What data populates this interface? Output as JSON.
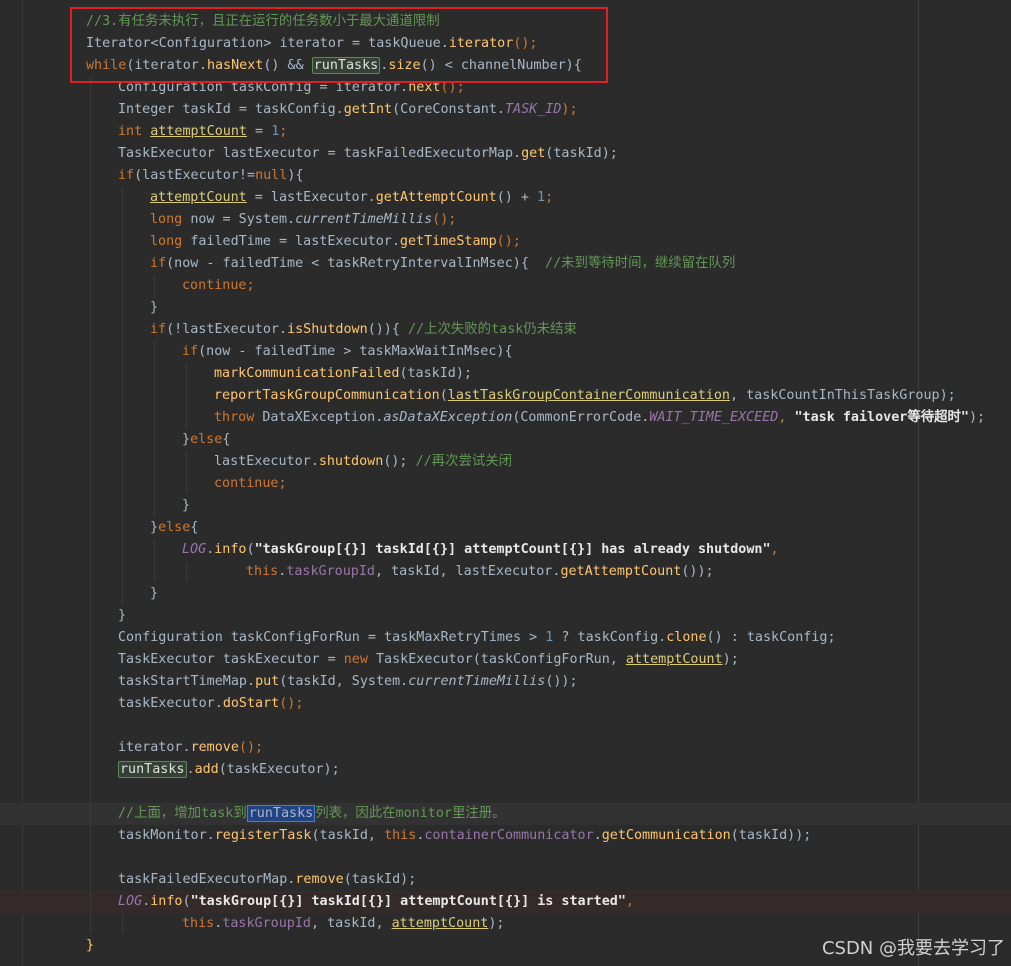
{
  "editor": {
    "lines": [
      {
        "segments": [
          {
            "t": "//3.有任务未执行，且正在运行的任务数小于最大通道限制",
            "c": "cm"
          }
        ]
      },
      {
        "segments": [
          {
            "t": "Iterator",
            "c": ""
          },
          {
            "t": "<",
            "c": "gen"
          },
          {
            "t": "Configuration",
            "c": ""
          },
          {
            "t": "> iterator = taskQueue.",
            "c": ""
          },
          {
            "t": "iterator",
            "c": "fn"
          },
          {
            "t": "();",
            "c": "kw"
          }
        ]
      },
      {
        "segments": [
          {
            "t": "while",
            "c": "kw"
          },
          {
            "t": "(iterator.",
            "c": ""
          },
          {
            "t": "hasNext",
            "c": "fn"
          },
          {
            "t": "() && ",
            "c": ""
          },
          {
            "t": "runTasks",
            "c": "hl"
          },
          {
            "t": ".",
            "c": ""
          },
          {
            "t": "size",
            "c": "fn"
          },
          {
            "t": "() < channelNumber){",
            "c": ""
          }
        ]
      },
      {
        "segments": [
          {
            "t": "Configuration taskConfig = iterator.",
            "c": ""
          },
          {
            "t": "next",
            "c": "fn"
          },
          {
            "t": "();",
            "c": "kw"
          }
        ]
      },
      {
        "segments": [
          {
            "t": "Integer taskId = taskConfig.",
            "c": ""
          },
          {
            "t": "getInt",
            "c": "fn"
          },
          {
            "t": "(CoreConstant.",
            "c": ""
          },
          {
            "t": "TASK_ID",
            "c": "sfld"
          },
          {
            "t": ");",
            "c": "kw"
          }
        ]
      },
      {
        "segments": [
          {
            "t": "int ",
            "c": "kw"
          },
          {
            "t": "attemptCount",
            "c": "und"
          },
          {
            "t": " = ",
            "c": ""
          },
          {
            "t": "1",
            "c": "num"
          },
          {
            "t": ";",
            "c": "kw"
          }
        ]
      },
      {
        "segments": [
          {
            "t": "TaskExecutor lastExecutor = taskFailedExecutorMap.",
            "c": ""
          },
          {
            "t": "get",
            "c": "fn"
          },
          {
            "t": "(taskId);",
            "c": ""
          }
        ]
      },
      {
        "segments": [
          {
            "t": "if",
            "c": "kw"
          },
          {
            "t": "(lastExecutor!=",
            "c": ""
          },
          {
            "t": "null",
            "c": "kw"
          },
          {
            "t": "){",
            "c": ""
          }
        ]
      },
      {
        "segments": [
          {
            "t": "attemptCount",
            "c": "und"
          },
          {
            "t": " = lastExecutor.",
            "c": ""
          },
          {
            "t": "getAttemptCount",
            "c": "fn"
          },
          {
            "t": "() + ",
            "c": ""
          },
          {
            "t": "1",
            "c": "num"
          },
          {
            "t": ";",
            "c": "kw"
          }
        ]
      },
      {
        "segments": [
          {
            "t": "long ",
            "c": "kw"
          },
          {
            "t": "now = System.",
            "c": ""
          },
          {
            "t": "currentTimeMillis",
            "c": "sm"
          },
          {
            "t": "();",
            "c": "kw"
          }
        ]
      },
      {
        "segments": [
          {
            "t": "long ",
            "c": "kw"
          },
          {
            "t": "failedTime = lastExecutor.",
            "c": ""
          },
          {
            "t": "getTimeStamp",
            "c": "fn"
          },
          {
            "t": "();",
            "c": "kw"
          }
        ]
      },
      {
        "segments": [
          {
            "t": "if",
            "c": "kw"
          },
          {
            "t": "(now - failedTime < taskRetryIntervalInMsec){  ",
            "c": ""
          },
          {
            "t": "//未到等待时间，继续留在队列",
            "c": "cm"
          }
        ]
      },
      {
        "segments": [
          {
            "t": "continue;",
            "c": "kw"
          }
        ]
      },
      {
        "segments": [
          {
            "t": "}",
            "c": ""
          }
        ]
      },
      {
        "segments": [
          {
            "t": "if",
            "c": "kw"
          },
          {
            "t": "(!lastExecutor.",
            "c": ""
          },
          {
            "t": "isShutdown",
            "c": "fn"
          },
          {
            "t": "()){ ",
            "c": ""
          },
          {
            "t": "//上次失败的task仍未结束",
            "c": "cm"
          }
        ]
      },
      {
        "segments": [
          {
            "t": "if",
            "c": "kw"
          },
          {
            "t": "(now - failedTime > taskMaxWaitInMsec){",
            "c": ""
          }
        ]
      },
      {
        "segments": [
          {
            "t": "markCommunicationFailed",
            "c": "fn"
          },
          {
            "t": "(taskId);",
            "c": ""
          }
        ]
      },
      {
        "segments": [
          {
            "t": "reportTaskGroupCommunication",
            "c": "fn"
          },
          {
            "t": "(",
            "c": ""
          },
          {
            "t": "lastTaskGroupContainerCommunication",
            "c": "und"
          },
          {
            "t": ", taskCountInThisTaskGroup);",
            "c": ""
          }
        ]
      },
      {
        "segments": [
          {
            "t": "throw ",
            "c": "kw"
          },
          {
            "t": "DataXException.",
            "c": ""
          },
          {
            "t": "asDataXException",
            "c": "sm"
          },
          {
            "t": "(CommonErrorCode.",
            "c": ""
          },
          {
            "t": "WAIT_TIME_EXCEED",
            "c": "sfld"
          },
          {
            "t": ", ",
            "c": "kw"
          },
          {
            "t": "\"task failover等待超时\"",
            "c": "str2"
          },
          {
            "t": ");",
            "c": ""
          }
        ]
      },
      {
        "segments": [
          {
            "t": "}",
            "c": ""
          },
          {
            "t": "else",
            "c": "kw"
          },
          {
            "t": "{",
            "c": ""
          }
        ]
      },
      {
        "segments": [
          {
            "t": "lastExecutor.",
            "c": ""
          },
          {
            "t": "shutdown",
            "c": "fn"
          },
          {
            "t": "(); ",
            "c": ""
          },
          {
            "t": "//再次尝试关闭",
            "c": "cm"
          }
        ]
      },
      {
        "segments": [
          {
            "t": "continue;",
            "c": "kw"
          }
        ]
      },
      {
        "segments": [
          {
            "t": "}",
            "c": ""
          }
        ]
      },
      {
        "segments": [
          {
            "t": "}",
            "c": ""
          },
          {
            "t": "else",
            "c": "kw"
          },
          {
            "t": "{",
            "c": ""
          }
        ]
      },
      {
        "segments": [
          {
            "t": "LOG",
            "c": "sfld"
          },
          {
            "t": ".",
            "c": ""
          },
          {
            "t": "info",
            "c": "fn"
          },
          {
            "t": "(",
            "c": ""
          },
          {
            "t": "\"taskGroup[{}] taskId[{}] attemptCount[{}] has already shutdown\"",
            "c": "str2"
          },
          {
            "t": ",",
            "c": "kw"
          }
        ]
      },
      {
        "segments": [
          {
            "t": "this",
            "c": "kw"
          },
          {
            "t": ".",
            "c": ""
          },
          {
            "t": "taskGroupId",
            "c": "fld"
          },
          {
            "t": ", taskId, lastExecutor.",
            "c": ""
          },
          {
            "t": "getAttemptCount",
            "c": "fn"
          },
          {
            "t": "());",
            "c": ""
          }
        ]
      },
      {
        "segments": [
          {
            "t": "}",
            "c": ""
          }
        ]
      },
      {
        "segments": [
          {
            "t": "}",
            "c": ""
          }
        ]
      },
      {
        "segments": [
          {
            "t": "Configuration taskConfigForRun = taskMaxRetryTimes > ",
            "c": ""
          },
          {
            "t": "1",
            "c": "num"
          },
          {
            "t": " ? taskConfig.",
            "c": ""
          },
          {
            "t": "clone",
            "c": "fn"
          },
          {
            "t": "() : taskConfig;",
            "c": ""
          }
        ]
      },
      {
        "segments": [
          {
            "t": "TaskExecutor taskExecutor = ",
            "c": ""
          },
          {
            "t": "new ",
            "c": "kw"
          },
          {
            "t": "TaskExecutor(taskConfigForRun, ",
            "c": ""
          },
          {
            "t": "attemptCount",
            "c": "und"
          },
          {
            "t": ");",
            "c": ""
          }
        ]
      },
      {
        "segments": [
          {
            "t": "taskStartTimeMap.",
            "c": ""
          },
          {
            "t": "put",
            "c": "fn"
          },
          {
            "t": "(taskId, System.",
            "c": ""
          },
          {
            "t": "currentTimeMillis",
            "c": "sm"
          },
          {
            "t": "());",
            "c": ""
          }
        ]
      },
      {
        "segments": [
          {
            "t": "taskExecutor.",
            "c": ""
          },
          {
            "t": "doStart",
            "c": "fn"
          },
          {
            "t": "();",
            "c": "kw"
          }
        ]
      },
      {
        "segments": []
      },
      {
        "segments": [
          {
            "t": "iterator.",
            "c": ""
          },
          {
            "t": "remove",
            "c": "fn"
          },
          {
            "t": "();",
            "c": "kw"
          }
        ]
      },
      {
        "segments": [
          {
            "t": "runTasks",
            "c": "hl"
          },
          {
            "t": ".",
            "c": ""
          },
          {
            "t": "add",
            "c": "fn"
          },
          {
            "t": "(taskExecutor);",
            "c": ""
          }
        ]
      },
      {
        "segments": []
      },
      {
        "segments": [
          {
            "t": "//上面，增加task到",
            "c": "cm"
          },
          {
            "t": "runTasks",
            "c": "hlsel"
          },
          {
            "t": "列表，因此在monitor里注册。",
            "c": "cm"
          }
        ]
      },
      {
        "segments": [
          {
            "t": "taskMonitor.",
            "c": ""
          },
          {
            "t": "registerTask",
            "c": "fn"
          },
          {
            "t": "(taskId, ",
            "c": ""
          },
          {
            "t": "this",
            "c": "kw"
          },
          {
            "t": ".",
            "c": ""
          },
          {
            "t": "containerCommunicator",
            "c": "fld"
          },
          {
            "t": ".",
            "c": ""
          },
          {
            "t": "getCommunication",
            "c": "fn"
          },
          {
            "t": "(taskId));",
            "c": ""
          }
        ]
      },
      {
        "segments": []
      },
      {
        "segments": [
          {
            "t": "taskFailedExecutorMap.",
            "c": ""
          },
          {
            "t": "remove",
            "c": "fn"
          },
          {
            "t": "(taskId);",
            "c": ""
          }
        ]
      },
      {
        "segments": [
          {
            "t": "LOG",
            "c": "sfld"
          },
          {
            "t": ".",
            "c": ""
          },
          {
            "t": "info",
            "c": "fn"
          },
          {
            "t": "(",
            "c": ""
          },
          {
            "t": "\"taskGroup[{}] taskId[{}] attemptCount[{}] is started\"",
            "c": "str2"
          },
          {
            "t": ",",
            "c": "kw"
          }
        ]
      },
      {
        "segments": [
          {
            "t": "this",
            "c": "kw"
          },
          {
            "t": ".",
            "c": ""
          },
          {
            "t": "taskGroupId",
            "c": "fld"
          },
          {
            "t": ", taskId, ",
            "c": ""
          },
          {
            "t": "attemptCount",
            "c": "und"
          },
          {
            "t": ");",
            "c": ""
          }
        ]
      },
      {
        "segments": [
          {
            "t": "}",
            "c": "fn"
          }
        ]
      }
    ]
  },
  "watermark": "CSDN @我要去学习了",
  "colors": {
    "background": "#2b2b2b",
    "keyword": "#cc7832",
    "method": "#ffc66d",
    "comment": "#629755",
    "number": "#6897bb",
    "field": "#9876aa",
    "highlight_box": "#e02020"
  }
}
